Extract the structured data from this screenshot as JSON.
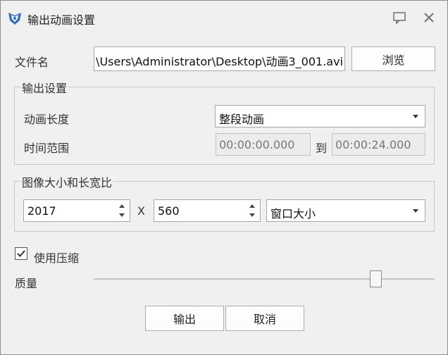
{
  "window": {
    "title": "输出动画设置",
    "icons": {
      "app": "app-logo-icon",
      "help": "help-icon",
      "close": "close-icon"
    }
  },
  "file": {
    "label": "文件名",
    "value": "\\Users\\Administrator\\Desktop\\动画3_001.avi",
    "browse_label": "浏览"
  },
  "output_settings": {
    "legend": "输出设置",
    "length_label": "动画长度",
    "length_value": "整段动画",
    "range_label": "时间范围",
    "range_start": "00:00:00.000",
    "range_to": "到",
    "range_end": "00:00:24.000"
  },
  "image_size": {
    "legend": "图像大小和长宽比",
    "width": "2017",
    "separator": "X",
    "height": "560",
    "preset": "窗口大小"
  },
  "compression": {
    "label": "使用压缩",
    "checked": true
  },
  "quality": {
    "label": "质量",
    "level": 0.84
  },
  "buttons": {
    "output": "输出",
    "cancel": "取消"
  },
  "colors": {
    "background": "#f0f0f0",
    "border": "#a8a8a8",
    "icon_blue": "#1f5fa8"
  }
}
